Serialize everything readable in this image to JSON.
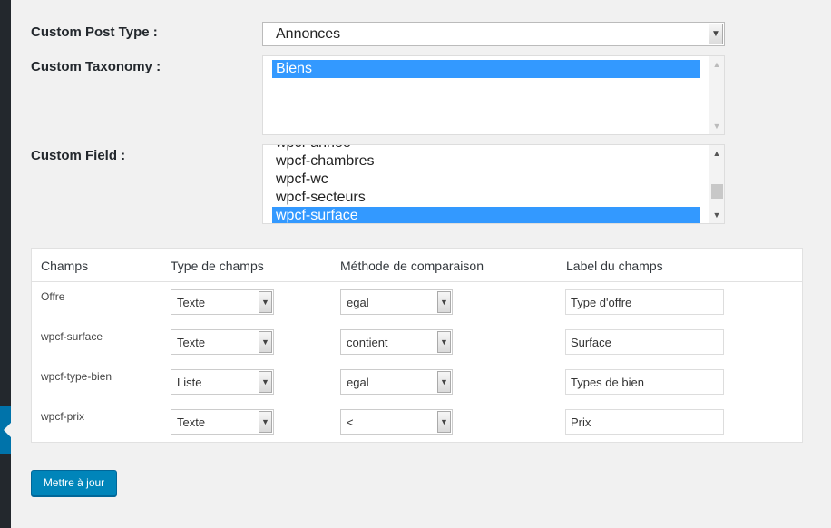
{
  "form": {
    "post_type_label": "Custom Post Type :",
    "post_type_value": "Annonces",
    "taxonomy_label": "Custom Taxonomy :",
    "taxonomy_options": [
      "Biens"
    ],
    "taxonomy_selected": "Biens",
    "field_label": "Custom Field :",
    "field_options": [
      "wpcf-annee",
      "wpcf-chambres",
      "wpcf-wc",
      "wpcf-secteurs",
      "wpcf-surface"
    ],
    "field_selected": "wpcf-surface"
  },
  "table": {
    "headers": [
      "Champs",
      "Type de champs",
      "Méthode de comparaison",
      "Label du champs"
    ],
    "rows": [
      {
        "champ": "Offre",
        "type": "Texte",
        "methode": "egal",
        "label": "Type d'offre"
      },
      {
        "champ": "wpcf-surface",
        "type": "Texte",
        "methode": "contient",
        "label": "Surface"
      },
      {
        "champ": "wpcf-type-bien",
        "type": "Liste",
        "methode": "egal",
        "label": "Types de bien"
      },
      {
        "champ": "wpcf-prix",
        "type": "Texte",
        "methode": "<",
        "label": "Prix"
      }
    ]
  },
  "actions": {
    "update_label": "Mettre à jour"
  },
  "icons": {
    "dropdown": "chevron-down-icon",
    "scroll_up": "chevron-up-icon",
    "menu_indicator": "caret-left-icon"
  },
  "colors": {
    "accent": "#0085ba",
    "selection": "#3399ff",
    "admin_bar": "#23282d"
  }
}
